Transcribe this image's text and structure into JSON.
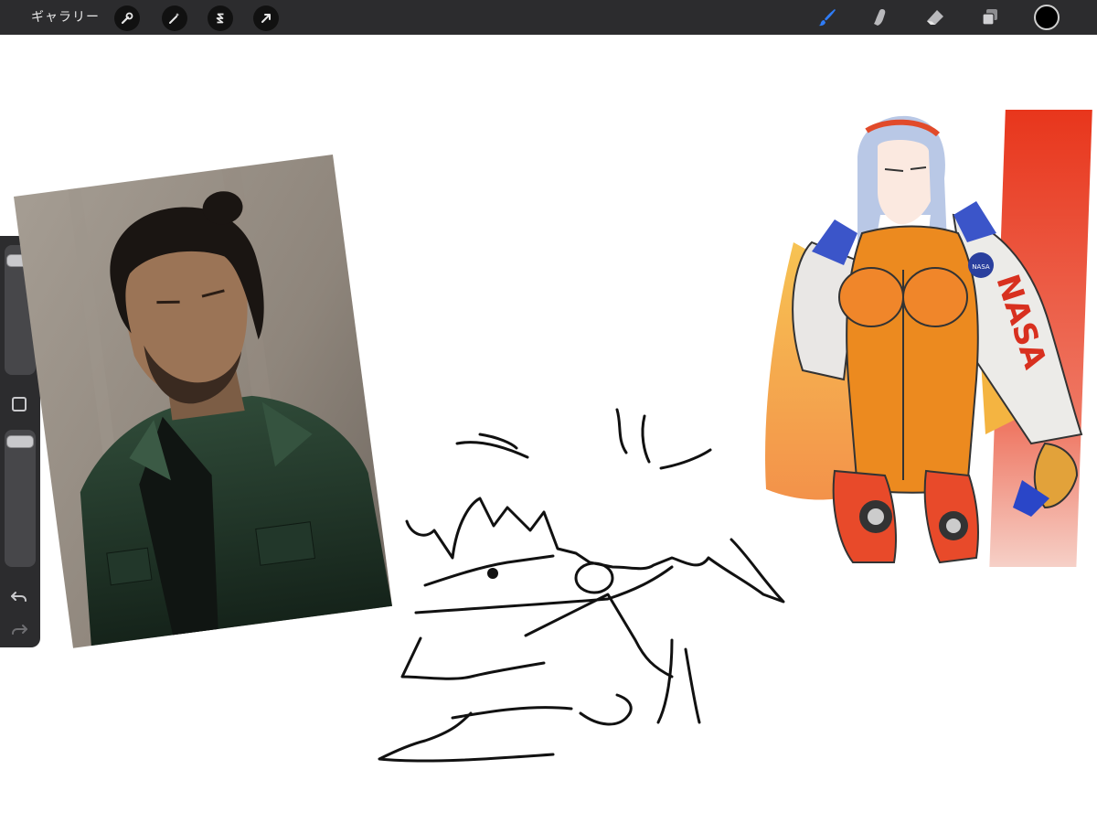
{
  "app": {
    "gallery_label": "ギャラリー"
  },
  "toolbar": {
    "left_tools": [
      {
        "name": "actions",
        "icon": "wrench-icon"
      },
      {
        "name": "adjustments",
        "icon": "magic-wand-icon"
      },
      {
        "name": "selection",
        "icon": "selection-s-icon"
      },
      {
        "name": "transform",
        "icon": "arrow-cursor-icon"
      }
    ],
    "right_tools": [
      {
        "name": "brush",
        "icon": "brush-icon",
        "active": true
      },
      {
        "name": "smudge",
        "icon": "smudge-finger-icon"
      },
      {
        "name": "eraser",
        "icon": "eraser-icon"
      },
      {
        "name": "layers",
        "icon": "layers-icon"
      }
    ],
    "current_color": "#000000",
    "accent_color": "#2f7cf6"
  },
  "sidebar": {
    "brush_size_level": 0.92,
    "opacity_level": 0.95,
    "undo_icon": "undo-icon",
    "redo_icon": "redo-icon"
  },
  "canvas": {
    "background": "#ffffff",
    "artworks": [
      {
        "name": "portrait-painting",
        "signature_text": "NASA"
      }
    ]
  },
  "jacket_text": "NASA"
}
